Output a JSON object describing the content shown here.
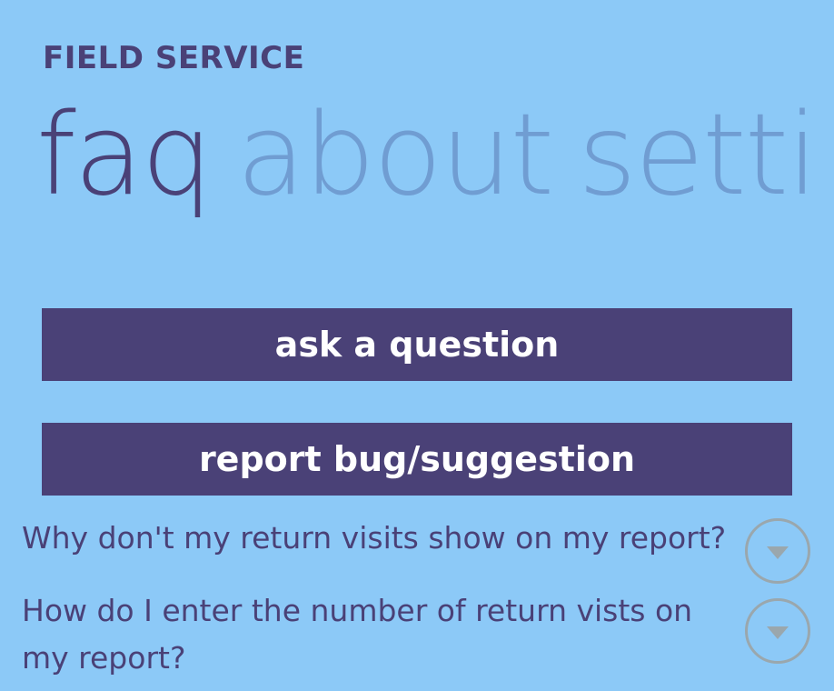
{
  "app": {
    "title": "FIELD SERVICE"
  },
  "pivot": {
    "items": [
      {
        "label": "faq",
        "active": true
      },
      {
        "label": "about",
        "active": false
      },
      {
        "label": "setti",
        "active": false
      }
    ]
  },
  "actions": {
    "ask_label": "ask a question",
    "report_label": "report bug/suggestion"
  },
  "faq": {
    "items": [
      {
        "question": "Why don't my return visits show on my report?",
        "expand_icon": "chevron-down-icon"
      },
      {
        "question": "How do I enter the number of return vists on my report?",
        "expand_icon": "chevron-down-icon"
      }
    ]
  },
  "colors": {
    "background": "#8cc9f7",
    "accent": "#4a4177",
    "inactive_pivot": "#709dd2",
    "button_text": "#ffffff",
    "icon_border": "#9aa7ad"
  }
}
